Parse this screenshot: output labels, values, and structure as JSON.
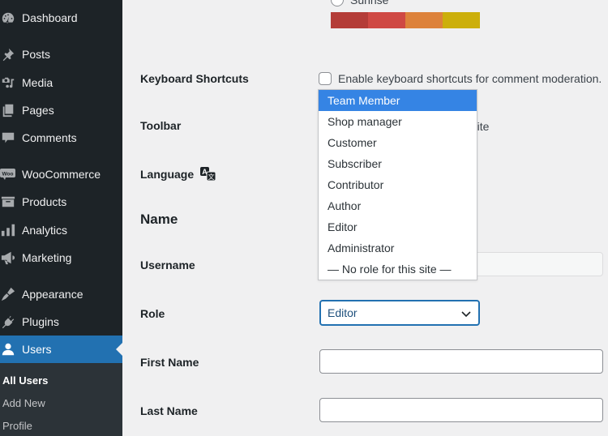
{
  "sidebar": {
    "items": [
      {
        "label": "Dashboard",
        "icon": "dashboard-icon"
      },
      {
        "label": "Posts",
        "icon": "pin-icon"
      },
      {
        "label": "Media",
        "icon": "media-icon"
      },
      {
        "label": "Pages",
        "icon": "pages-icon"
      },
      {
        "label": "Comments",
        "icon": "comment-icon"
      },
      {
        "label": "WooCommerce",
        "icon": "woo-icon"
      },
      {
        "label": "Products",
        "icon": "archive-icon"
      },
      {
        "label": "Analytics",
        "icon": "bar-chart-icon"
      },
      {
        "label": "Marketing",
        "icon": "megaphone-icon"
      },
      {
        "label": "Appearance",
        "icon": "paintbrush-icon"
      },
      {
        "label": "Plugins",
        "icon": "plug-icon"
      },
      {
        "label": "Users",
        "icon": "user-icon",
        "active": true
      }
    ],
    "submenu": [
      {
        "label": "All Users",
        "current": true
      },
      {
        "label": "Add New"
      },
      {
        "label": "Profile"
      }
    ]
  },
  "colors": {
    "accent": "#2271b1",
    "dropdown_highlight": "#3584e4",
    "sidebar_bg": "#1d2327",
    "scheme_swatches": [
      "#b43c38",
      "#cf4944",
      "#dd823b",
      "#ccaf0b"
    ]
  },
  "form": {
    "color_scheme": {
      "radio_label": "Sunrise"
    },
    "keyboard_shortcuts": {
      "label": "Keyboard Shortcuts",
      "checkbox_label": "Enable keyboard shortcuts for comment moderation.",
      "checked": false
    },
    "toolbar": {
      "label": "Toolbar",
      "visible_text": "g site"
    },
    "language": {
      "label": "Language",
      "icon": "translation-icon"
    },
    "name_section_title": "Name",
    "username": {
      "label": "Username",
      "value": ""
    },
    "role": {
      "label": "Role",
      "selected": "Editor",
      "options": [
        "Team Member",
        "Shop manager",
        "Customer",
        "Subscriber",
        "Contributor",
        "Author",
        "Editor",
        "Administrator",
        "— No role for this site —"
      ],
      "highlighted_option": "Team Member"
    },
    "first_name": {
      "label": "First Name",
      "value": ""
    },
    "last_name": {
      "label": "Last Name",
      "value": ""
    }
  }
}
